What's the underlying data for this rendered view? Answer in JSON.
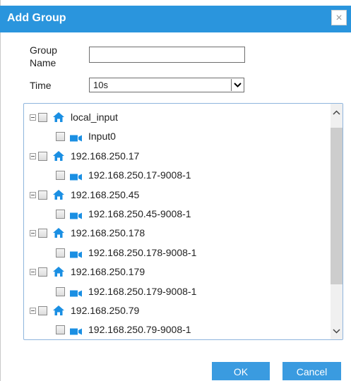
{
  "dialog": {
    "title": "Add Group",
    "close_symbol": "×"
  },
  "form": {
    "group_name_label_line1": "Group",
    "group_name_label_line2": "Name",
    "group_name_value": "",
    "time_label": "Time",
    "time_value": "10s"
  },
  "tree": {
    "nodes": [
      {
        "label": "local_input",
        "type": "host"
      },
      {
        "label": "Input0",
        "type": "camera"
      },
      {
        "label": "192.168.250.17",
        "type": "host"
      },
      {
        "label": "192.168.250.17-9008-1",
        "type": "camera"
      },
      {
        "label": "192.168.250.45",
        "type": "host"
      },
      {
        "label": "192.168.250.45-9008-1",
        "type": "camera"
      },
      {
        "label": "192.168.250.178",
        "type": "host"
      },
      {
        "label": "192.168.250.178-9008-1",
        "type": "camera"
      },
      {
        "label": "192.168.250.179",
        "type": "host"
      },
      {
        "label": "192.168.250.179-9008-1",
        "type": "camera"
      },
      {
        "label": "192.168.250.79",
        "type": "host"
      },
      {
        "label": "192.168.250.79-9008-1",
        "type": "camera"
      }
    ]
  },
  "buttons": {
    "ok": "OK",
    "cancel": "Cancel"
  },
  "colors": {
    "title_bar": "#2a95dd",
    "icon_blue": "#1a8fe3",
    "button": "#3a9be0"
  },
  "icons": [
    "close-icon",
    "home-icon",
    "camera-icon",
    "chevron-down-icon",
    "chevron-up-icon",
    "tree-collapse-icon"
  ]
}
